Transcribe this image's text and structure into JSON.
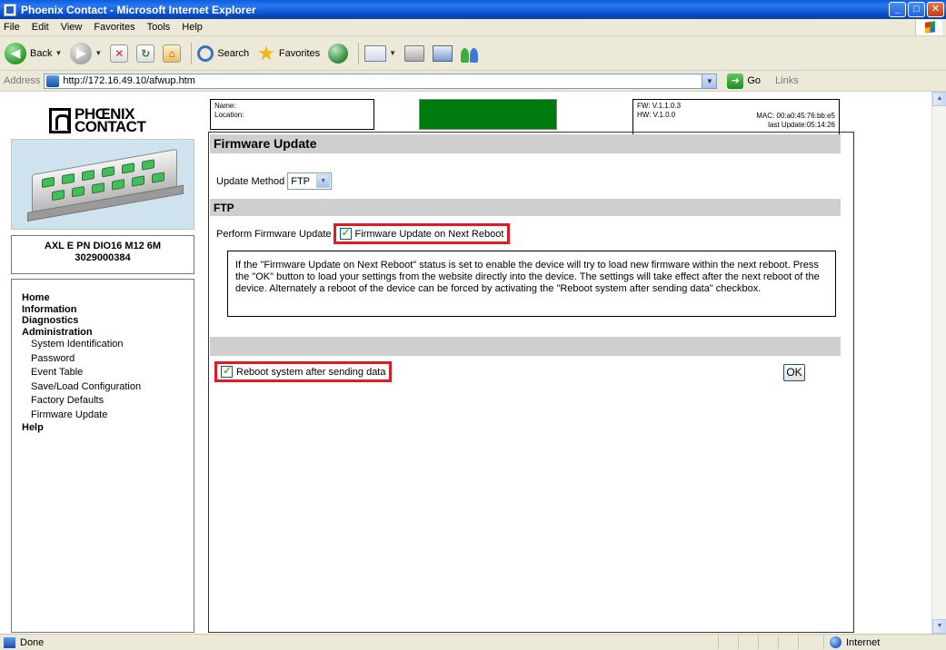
{
  "window": {
    "title": "Phoenix Contact - Microsoft Internet Explorer",
    "buttons": [
      "_",
      "□",
      "✕"
    ]
  },
  "menu": [
    "File",
    "Edit",
    "View",
    "Favorites",
    "Tools",
    "Help"
  ],
  "toolbar": {
    "back_label": "Back",
    "search_label": "Search",
    "favorites_label": "Favorites"
  },
  "address": {
    "label": "Address",
    "url": "http://172.16.49.10/afwup.htm",
    "go_label": "Go",
    "links_label": "Links"
  },
  "device": {
    "product_name": "AXL E PN DIO16 M12 6M",
    "product_number": "3029000384",
    "name_label": "Name:",
    "location_label": "Location:",
    "fw": "FW: V.1.1.0.3",
    "hw": "HW: V.1.0.0",
    "mac": "MAC: 00:a0:45:76:bb:e5",
    "last_update": "last Update:05:14:26"
  },
  "nav": {
    "home": "Home",
    "information": "Information",
    "diagnostics": "Diagnostics",
    "administration": "Administration",
    "sub": [
      "System Identification",
      "Password",
      "Event Table",
      "Save/Load Configuration",
      "Factory Defaults",
      "Firmware Update"
    ],
    "help": "Help"
  },
  "page": {
    "title": "Firmware Update",
    "update_method_label": "Update Method",
    "update_method_value": "FTP",
    "ftp_header": "FTP",
    "perform_label": "Perform Firmware Update",
    "fw_next_reboot_label": "Firmware Update on Next Reboot",
    "fw_next_reboot_checked": true,
    "info_text": "If the \"Firmware Update on Next Reboot\" status is set to enable the device will try to load new firmware within the next reboot. Press the \"OK\" button to load your settings from the website directly into the device. The settings will take effect after the next reboot of the device. Alternately a reboot of the device can be forced by activating the \"Reboot system after sending data\" checkbox.",
    "reboot_label": "Reboot system after sending data",
    "reboot_checked": true,
    "ok_label": "OK"
  },
  "status": {
    "left": "Done",
    "zone": "Internet"
  },
  "colors": {
    "highlight": "#e11b22",
    "status_green": "#007a0e",
    "section_bar": "#cfcfcf"
  }
}
